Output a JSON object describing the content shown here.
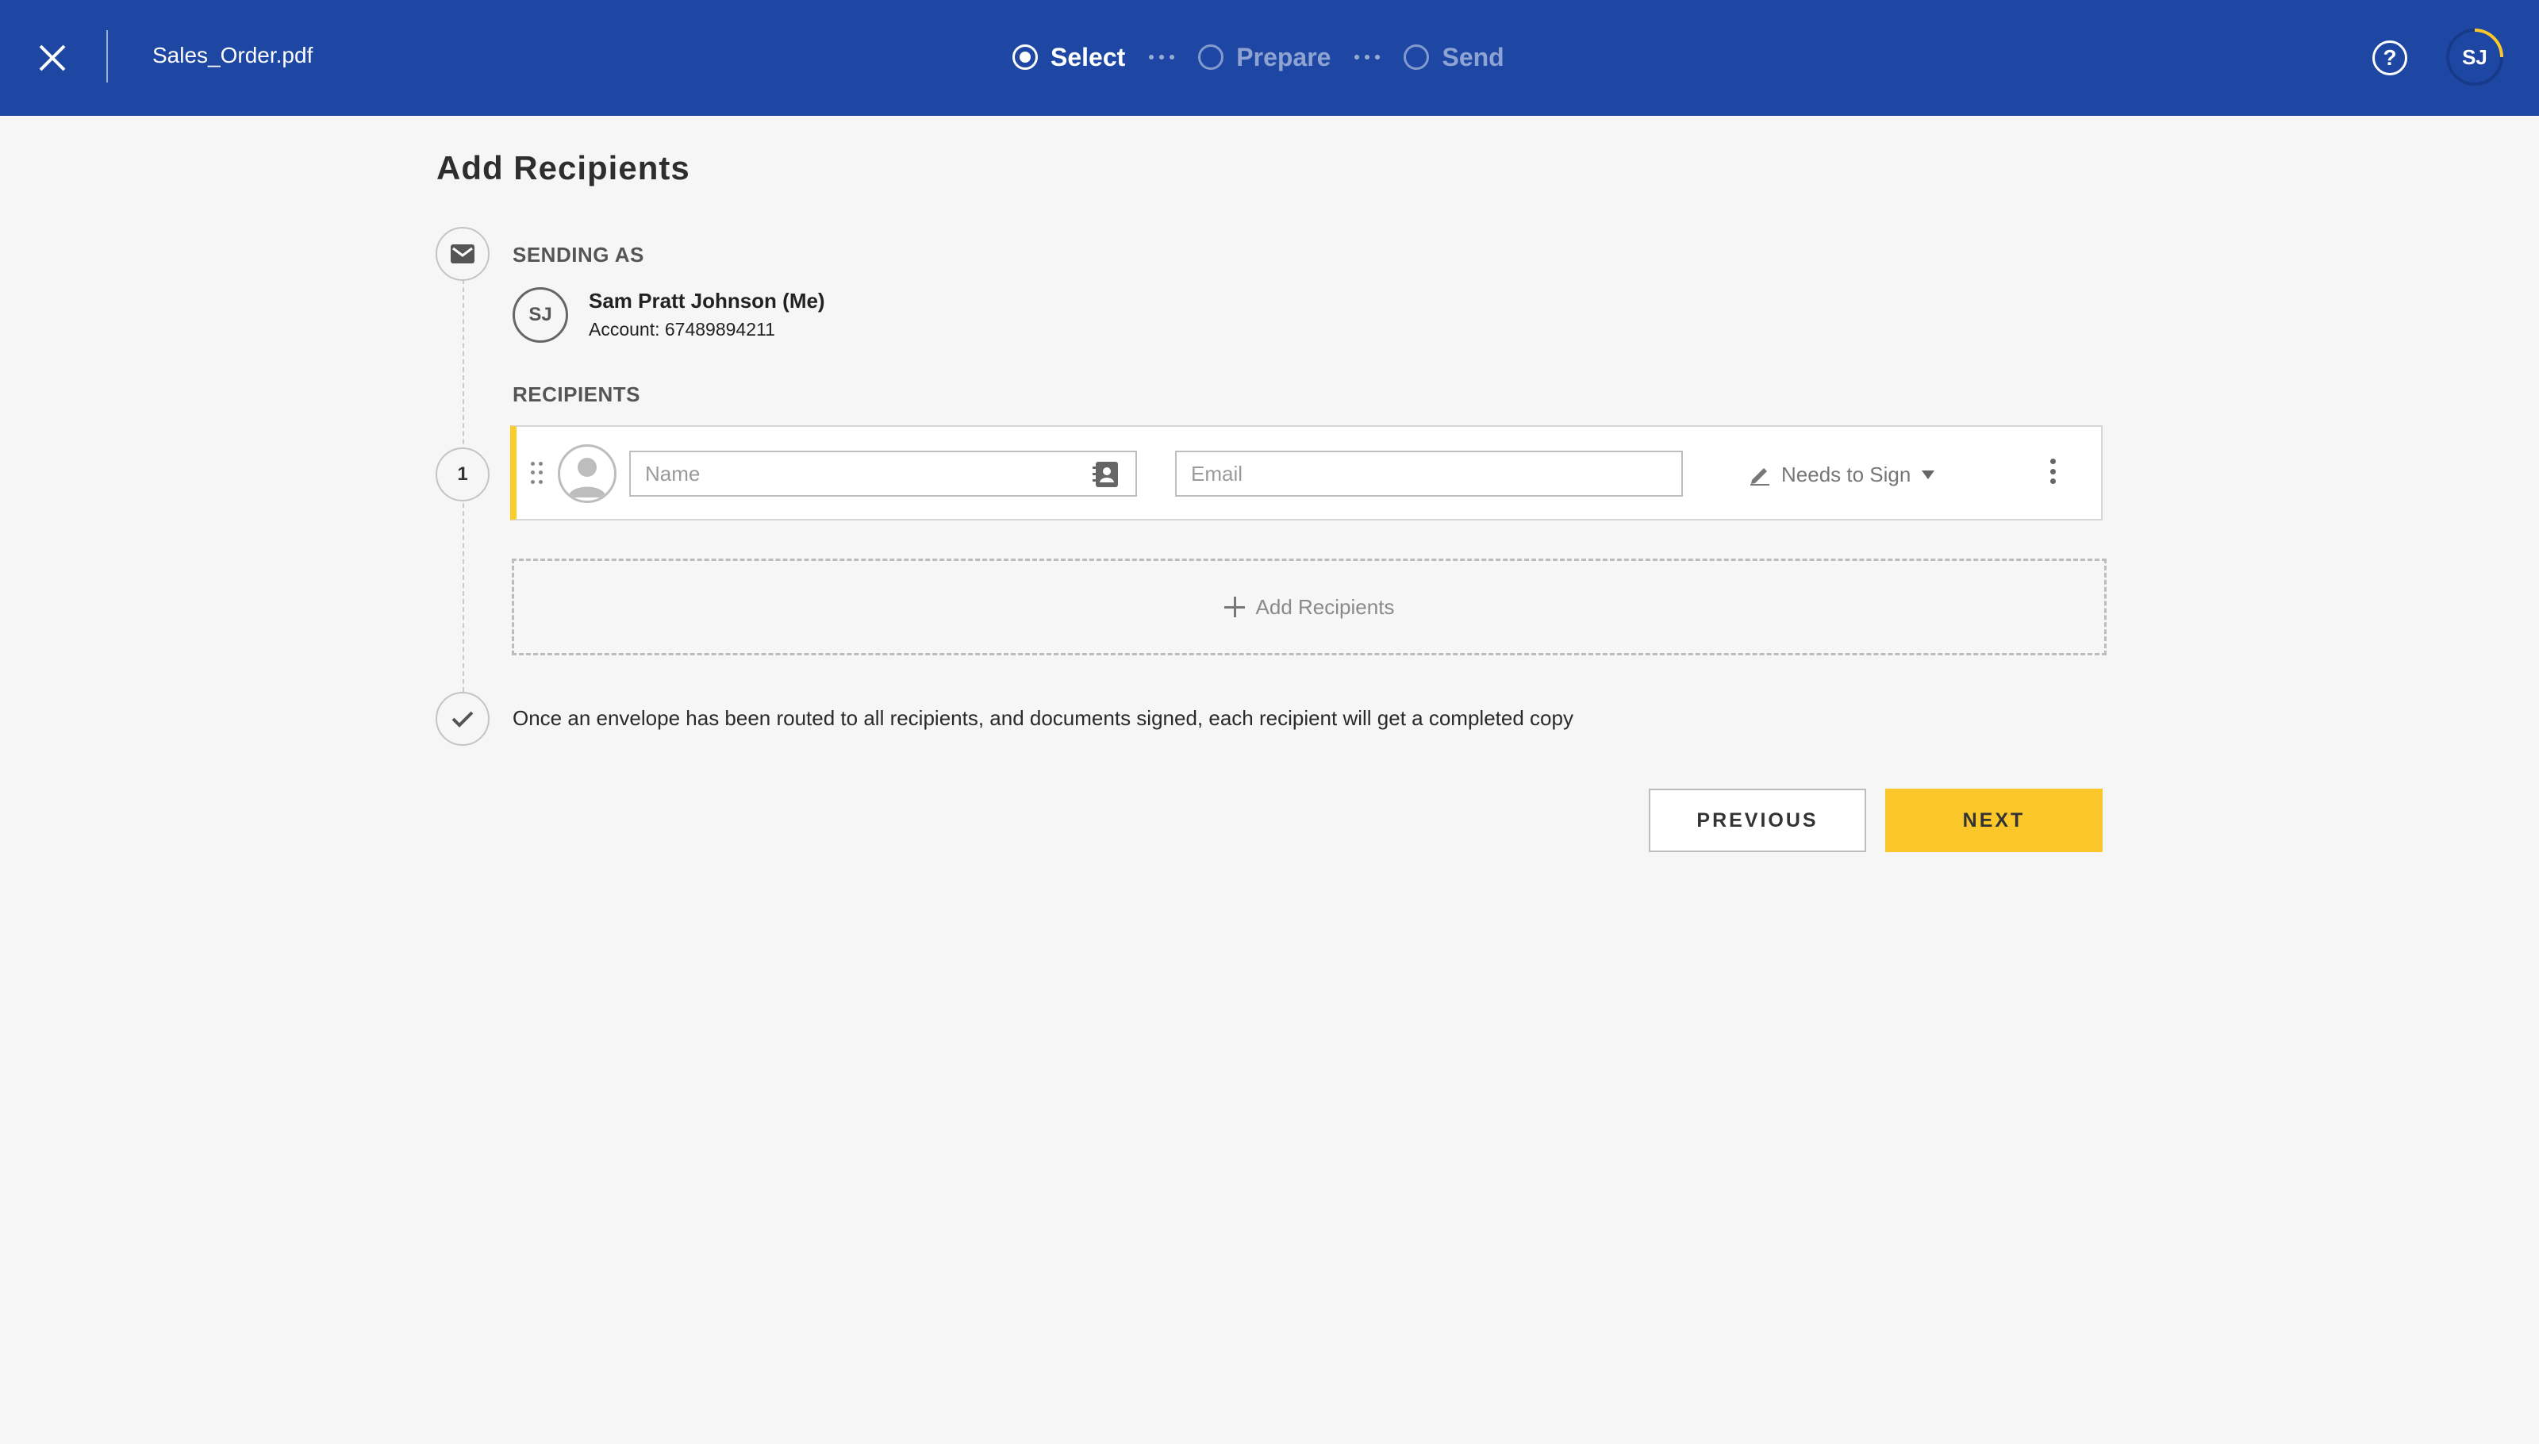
{
  "header": {
    "filename": "Sales_Order.pdf",
    "steps": [
      {
        "label": "Select",
        "active": true
      },
      {
        "label": "Prepare",
        "active": false
      },
      {
        "label": "Send",
        "active": false
      }
    ],
    "help_icon": "question-circle-icon",
    "user_initials": "SJ",
    "colors": {
      "bar": "#1d47a3",
      "progress_ring": "#fbc72a"
    }
  },
  "main": {
    "title": "Add Recipients",
    "sending_as": {
      "label": "SENDING AS",
      "initials": "SJ",
      "name": "Sam Pratt Johnson (Me)",
      "account": "Account: 67489894211"
    },
    "recipients": {
      "label": "RECIPIENTS",
      "items": [
        {
          "order": "1",
          "name_placeholder": "Name",
          "name_value": "",
          "email_placeholder": "Email",
          "email_value": "",
          "role": "Needs to Sign"
        }
      ],
      "add_label": "Add Recipients"
    },
    "completion_note": "Once an envelope has been routed to all recipients, and documents signed, each recipient will get a completed copy"
  },
  "footer": {
    "previous_label": "PREVIOUS",
    "next_label": "NEXT",
    "accent": "#fbc72a"
  }
}
